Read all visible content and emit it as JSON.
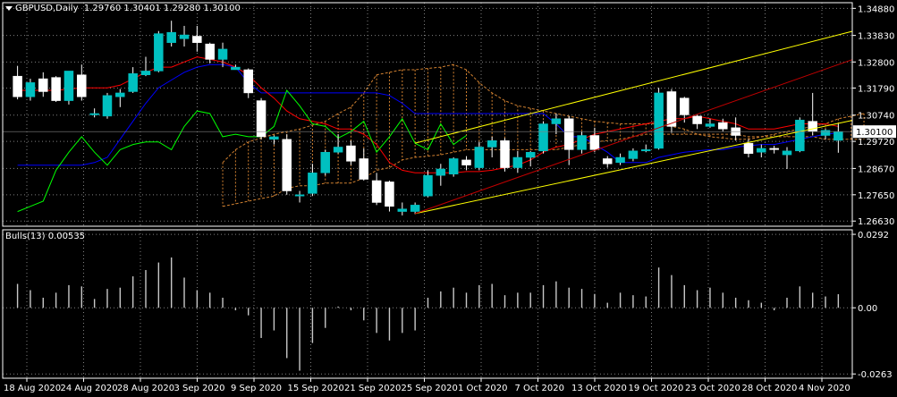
{
  "header": {
    "symbol": "GBPUSD,Daily",
    "ohlc": "1.29760 1.30401 1.29280 1.30100"
  },
  "indicator_header": {
    "name": "Bulls(13)",
    "value": "0.00535"
  },
  "colors": {
    "background": "#000000",
    "bull_candle": "#00c0c0",
    "bear_candle": "#ffffff",
    "kijun": "#0000ff",
    "tenkan": "#ff0000",
    "chikou": "#00ff00",
    "kumo": "#d08030",
    "channel": "#ffff00",
    "trend_red": "#c00000",
    "grid": "#808080",
    "price_label_bg": "#ffffff"
  },
  "chart_data": [
    {
      "type": "candlestick",
      "title": "GBPUSD,Daily",
      "y_ticks": [
        1.3488,
        1.3383,
        1.328,
        1.3179,
        1.3074,
        1.2972,
        1.2867,
        1.2765,
        1.2663
      ],
      "y_tick_labels": [
        "1.34880",
        "1.33830",
        "1.32800",
        "1.31790",
        "1.30740",
        "1.29720",
        "1.28670",
        "1.27650",
        "1.26630"
      ],
      "current_price": "1.30100",
      "ylim": [
        1.2643,
        1.351
      ],
      "x_labels": [
        "18 Aug 2020",
        "24 Aug 2020",
        "28 Aug 2020",
        "3 Sep 2020",
        "9 Sep 2020",
        "15 Sep 2020",
        "21 Sep 2020",
        "25 Sep 2020",
        "1 Oct 2020",
        "7 Oct 2020",
        "13 Oct 2020",
        "19 Oct 2020",
        "23 Oct 2020",
        "28 Oct 2020",
        "4 Nov 2020"
      ],
      "ohlc": [
        [
          1.3225,
          1.3265,
          1.3135,
          1.3145
        ],
        [
          1.3145,
          1.3215,
          1.313,
          1.32
        ],
        [
          1.3215,
          1.324,
          1.3145,
          1.3165
        ],
        [
          1.322,
          1.3225,
          1.3125,
          1.313
        ],
        [
          1.313,
          1.324,
          1.3115,
          1.3245
        ],
        [
          1.323,
          1.327,
          1.313,
          1.3145
        ],
        [
          1.3075,
          1.31,
          1.3065,
          1.308
        ],
        [
          1.307,
          1.316,
          1.306,
          1.315
        ],
        [
          1.3145,
          1.3175,
          1.3105,
          1.316
        ],
        [
          1.3165,
          1.326,
          1.316,
          1.3235
        ],
        [
          1.323,
          1.33,
          1.3225,
          1.3245
        ],
        [
          1.3245,
          1.34,
          1.324,
          1.339
        ],
        [
          1.3355,
          1.344,
          1.334,
          1.3395
        ],
        [
          1.337,
          1.342,
          1.334,
          1.3385
        ],
        [
          1.338,
          1.342,
          1.332,
          1.3355
        ],
        [
          1.335,
          1.3355,
          1.3275,
          1.329
        ],
        [
          1.329,
          1.3355,
          1.326,
          1.333
        ],
        [
          1.325,
          1.327,
          1.3255,
          1.326
        ],
        [
          1.325,
          1.3255,
          1.314,
          1.316
        ],
        [
          1.313,
          1.314,
          1.298,
          1.299
        ],
        [
          1.298,
          1.2995,
          1.296,
          1.299
        ],
        [
          1.298,
          1.3,
          1.2765,
          1.278
        ],
        [
          1.276,
          1.278,
          1.2735,
          1.2765
        ],
        [
          1.277,
          1.2885,
          1.276,
          1.285
        ],
        [
          1.285,
          1.294,
          1.284,
          1.293
        ],
        [
          1.293,
          1.3,
          1.2925,
          1.295
        ],
        [
          1.2955,
          1.2975,
          1.288,
          1.2895
        ],
        [
          1.2905,
          1.2945,
          1.282,
          1.2825
        ],
        [
          1.282,
          1.285,
          1.2725,
          1.2735
        ],
        [
          1.2815,
          1.282,
          1.27,
          1.272
        ],
        [
          1.27,
          1.2735,
          1.2685,
          1.271
        ],
        [
          1.27,
          1.2735,
          1.269,
          1.2725
        ],
        [
          1.276,
          1.286,
          1.2755,
          1.284
        ],
        [
          1.284,
          1.2885,
          1.28,
          1.2865
        ],
        [
          1.2845,
          1.291,
          1.2835,
          1.2905
        ],
        [
          1.29,
          1.2915,
          1.286,
          1.288
        ],
        [
          1.287,
          1.297,
          1.286,
          1.295
        ],
        [
          1.295,
          1.299,
          1.291,
          1.2975
        ],
        [
          1.2975,
          1.2985,
          1.2855,
          1.287
        ],
        [
          1.287,
          1.2935,
          1.285,
          1.291
        ],
        [
          1.291,
          1.2935,
          1.2875,
          1.293
        ],
        [
          1.2935,
          1.305,
          1.2925,
          1.304
        ],
        [
          1.304,
          1.308,
          1.3,
          1.306
        ],
        [
          1.306,
          1.307,
          1.288,
          1.294
        ],
        [
          1.294,
          1.301,
          1.2925,
          1.2995
        ],
        [
          1.2995,
          1.3025,
          1.293,
          1.294
        ],
        [
          1.2905,
          1.2915,
          1.287,
          1.2885
        ],
        [
          1.289,
          1.2925,
          1.288,
          1.291
        ],
        [
          1.2905,
          1.2945,
          1.2895,
          1.2935
        ],
        [
          1.2935,
          1.296,
          1.293,
          1.294
        ],
        [
          1.2945,
          1.318,
          1.294,
          1.316
        ],
        [
          1.3165,
          1.3175,
          1.3005,
          1.303
        ],
        [
          1.314,
          1.3145,
          1.3045,
          1.3075
        ],
        [
          1.307,
          1.3075,
          1.302,
          1.304
        ],
        [
          1.303,
          1.306,
          1.3025,
          1.304
        ],
        [
          1.3045,
          1.306,
          1.301,
          1.302
        ],
        [
          1.3025,
          1.3065,
          1.2975,
          1.2995
        ],
        [
          1.2965,
          1.298,
          1.291,
          1.2925
        ],
        [
          1.293,
          1.296,
          1.291,
          1.2945
        ],
        [
          1.2945,
          1.2955,
          1.2925,
          1.294
        ],
        [
          1.292,
          1.295,
          1.2865,
          1.2935
        ],
        [
          1.2935,
          1.3065,
          1.293,
          1.3055
        ],
        [
          1.305,
          1.316,
          1.2995,
          1.301
        ],
        [
          1.2995,
          1.302,
          1.298,
          1.3015
        ],
        [
          1.2976,
          1.304,
          1.2928,
          1.301
        ]
      ],
      "series": [
        {
          "name": "",
          "style": "kijun",
          "values": [
            1.288,
            1.288,
            1.288,
            1.288,
            1.288,
            1.288,
            1.289,
            1.291,
            1.298,
            1.305,
            1.312,
            1.318,
            1.321,
            1.324,
            1.326,
            1.327,
            1.327,
            1.326,
            1.32,
            1.316,
            1.316,
            1.316,
            1.316,
            1.316,
            1.316,
            1.316,
            1.316,
            1.316,
            1.316,
            1.315,
            1.312,
            1.308,
            1.308,
            1.308,
            1.308,
            1.308,
            1.308,
            1.308,
            1.308,
            1.308,
            1.308,
            1.308,
            1.304,
            1.299,
            1.299,
            1.296,
            1.293,
            1.289,
            1.289,
            1.289,
            1.291,
            1.292,
            1.293,
            1.2935,
            1.294,
            1.294,
            1.295,
            1.2955,
            1.296,
            1.296,
            1.297,
            1.298,
            1.299,
            1.3,
            1.3005
          ]
        },
        {
          "name": "",
          "style": "tenkan",
          "values": [
            1.317,
            1.317,
            1.317,
            1.317,
            1.3175,
            1.318,
            1.318,
            1.318,
            1.319,
            1.3215,
            1.324,
            1.326,
            1.326,
            1.328,
            1.33,
            1.329,
            1.328,
            1.326,
            1.323,
            1.318,
            1.314,
            1.309,
            1.306,
            1.305,
            1.304,
            1.302,
            1.302,
            1.3,
            1.296,
            1.289,
            1.286,
            1.285,
            1.285,
            1.285,
            1.285,
            1.2855,
            1.2855,
            1.286,
            1.287,
            1.288,
            1.29,
            1.293,
            1.295,
            1.296,
            1.298,
            1.3,
            1.301,
            1.302,
            1.303,
            1.304,
            1.305,
            1.306,
            1.306,
            1.307,
            1.306,
            1.305,
            1.304,
            1.302,
            1.302,
            1.302,
            1.303,
            1.304,
            1.304,
            1.304,
            1.303
          ]
        },
        {
          "name": "",
          "style": "chikou",
          "values": [
            1.27,
            1.272,
            1.274,
            1.286,
            1.293,
            1.299,
            1.293,
            1.288,
            1.294,
            1.296,
            1.297,
            1.297,
            1.294,
            1.303,
            1.309,
            1.308,
            1.299,
            1.3,
            1.299,
            1.299,
            1.303,
            1.317,
            1.311,
            1.304,
            1.303,
            1.2985,
            1.301,
            1.305,
            1.293,
            1.299,
            1.306,
            1.2965,
            1.294,
            1.304,
            1.296,
            1.2995
          ]
        },
        {
          "name": "",
          "style": "senkouA",
          "values": [
            1.289,
            1.294,
            1.297,
            1.2985,
            1.3,
            1.301,
            1.302,
            1.3035,
            1.305,
            1.308,
            1.3105,
            1.316,
            1.323,
            1.324,
            1.325,
            1.325,
            1.3255,
            1.326,
            1.327,
            1.325,
            1.32,
            1.316,
            1.313,
            1.311,
            1.31,
            1.309,
            1.308,
            1.307,
            1.306,
            1.305,
            1.3045,
            1.304,
            1.304,
            1.304,
            1.304,
            1.303,
            1.302,
            1.3,
            1.299,
            1.2985,
            1.298,
            1.298,
            1.299,
            1.3,
            1.301,
            1.302,
            1.303,
            1.304,
            1.306,
            1.307,
            1.308
          ]
        },
        {
          "name": "",
          "style": "senkouB",
          "values": [
            1.272,
            1.273,
            1.274,
            1.275,
            1.276,
            1.279,
            1.28,
            1.28,
            1.281,
            1.281,
            1.281,
            1.283,
            1.286,
            1.287,
            1.29,
            1.291,
            1.2915,
            1.292,
            1.293,
            1.294,
            1.294,
            1.294,
            1.294,
            1.294,
            1.294,
            1.294,
            1.294,
            1.295,
            1.296,
            1.297,
            1.2975,
            1.298,
            1.299,
            1.3,
            1.3,
            1.3,
            1.3,
            1.3,
            1.3,
            1.3,
            1.3,
            1.299,
            1.299,
            1.299,
            1.299,
            1.299,
            1.299,
            1.298,
            1.298,
            1.298,
            1.298
          ]
        },
        {
          "name": "",
          "style": "channel",
          "lines": [
            [
              [
                31,
                1.2692
              ],
              [
                64,
                1.3042
              ]
            ],
            [
              [
                31,
                1.2965
              ],
              [
                64,
                1.3385
              ]
            ]
          ]
        },
        {
          "name": "",
          "style": "trend_red",
          "lines": [
            [
              [
                31,
                1.2692
              ],
              [
                64,
                1.327
              ]
            ]
          ]
        }
      ]
    },
    {
      "type": "bar",
      "title": "Bulls(13) 0.00535",
      "y_tick_labels": [
        "0.0292",
        "0.00",
        "-0.0263"
      ],
      "y_ticks": [
        0.0292,
        0.0,
        -0.0263
      ],
      "ylim": [
        -0.028,
        0.031
      ],
      "values": [
        0.0095,
        0.007,
        0.004,
        0.006,
        0.009,
        0.0085,
        0.0035,
        0.0075,
        0.008,
        0.0125,
        0.015,
        0.018,
        0.02,
        0.012,
        0.007,
        0.006,
        0.004,
        -0.001,
        -0.003,
        -0.012,
        -0.009,
        -0.02,
        -0.025,
        -0.014,
        -0.008,
        0.0005,
        -0.001,
        -0.005,
        -0.01,
        -0.013,
        -0.01,
        -0.009,
        0.004,
        0.0065,
        0.008,
        0.006,
        0.009,
        0.0095,
        0.005,
        0.006,
        0.006,
        0.009,
        0.0105,
        0.008,
        0.0075,
        0.0055,
        0.002,
        0.006,
        0.005,
        0.0045,
        0.016,
        0.013,
        0.009,
        0.007,
        0.008,
        0.006,
        0.004,
        0.003,
        0.002,
        -0.001,
        0.004,
        0.0085,
        0.006,
        0.0045,
        0.0054
      ]
    }
  ]
}
